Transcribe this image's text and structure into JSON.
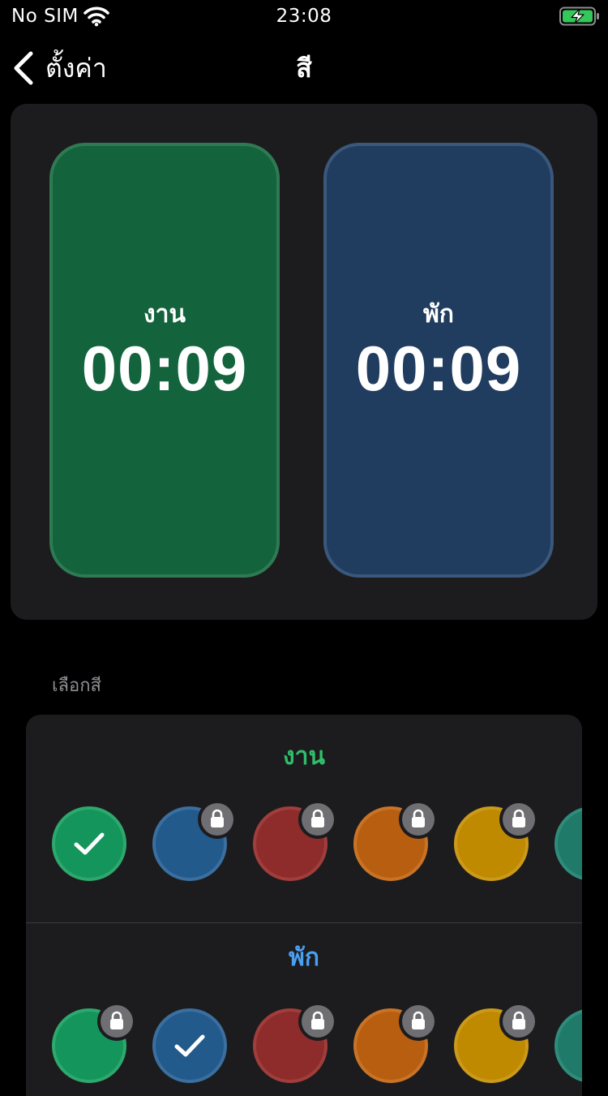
{
  "status_bar": {
    "carrier": "No SIM",
    "time": "23:08",
    "wifi_icon": "wifi-icon",
    "battery_icon": "battery-charging-icon",
    "battery_color": "#34c759"
  },
  "nav": {
    "back_label": "ตั้งค่า",
    "title": "สี"
  },
  "preview": {
    "work": {
      "label": "งาน",
      "time": "00:09",
      "color": "#13633d"
    },
    "rest": {
      "label": "พัก",
      "time": "00:09",
      "color": "#203c5e"
    }
  },
  "picker": {
    "section_header": "เลือกสี",
    "work": {
      "heading": "งาน",
      "heading_color": "#2fbf6a",
      "swatches": [
        {
          "name": "green",
          "fill": "#13955c",
          "border": "#2ea86c",
          "selected": true,
          "locked": false
        },
        {
          "name": "blue",
          "fill": "#235a8c",
          "border": "#3a6f9f",
          "selected": false,
          "locked": true
        },
        {
          "name": "red",
          "fill": "#8e2c2c",
          "border": "#a13e3c",
          "selected": false,
          "locked": true
        },
        {
          "name": "orange",
          "fill": "#b85e10",
          "border": "#c97326",
          "selected": false,
          "locked": true
        },
        {
          "name": "yellow",
          "fill": "#bf8a00",
          "border": "#cc9a1a",
          "selected": false,
          "locked": true
        },
        {
          "name": "teal",
          "fill": "#1f7a6a",
          "border": "#2f8c7b",
          "selected": false,
          "locked": false
        }
      ]
    },
    "rest": {
      "heading": "พัก",
      "heading_color": "#4a9ff0",
      "swatches": [
        {
          "name": "green",
          "fill": "#13955c",
          "border": "#2ea86c",
          "selected": false,
          "locked": true
        },
        {
          "name": "blue",
          "fill": "#235a8c",
          "border": "#3a6f9f",
          "selected": true,
          "locked": false
        },
        {
          "name": "red",
          "fill": "#8e2c2c",
          "border": "#a13e3c",
          "selected": false,
          "locked": true
        },
        {
          "name": "orange",
          "fill": "#b85e10",
          "border": "#c97326",
          "selected": false,
          "locked": true
        },
        {
          "name": "yellow",
          "fill": "#bf8a00",
          "border": "#cc9a1a",
          "selected": false,
          "locked": true
        },
        {
          "name": "teal",
          "fill": "#1f7a6a",
          "border": "#2f8c7b",
          "selected": false,
          "locked": false
        }
      ]
    }
  }
}
